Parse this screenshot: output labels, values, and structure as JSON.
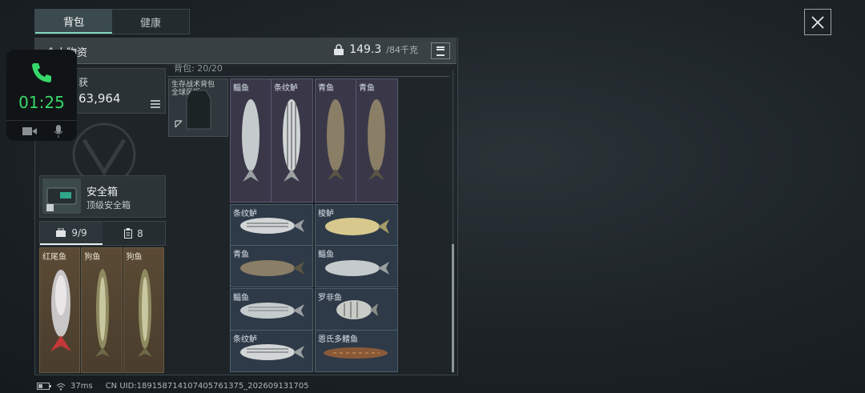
{
  "tabs": [
    {
      "label": "背包"
    },
    {
      "label": "健康"
    }
  ],
  "panel": {
    "title": "个人物资",
    "weight_value": "149.3",
    "weight_unit": "/84千克"
  },
  "value_box": {
    "label": "获",
    "value": "63,964"
  },
  "safe_box": {
    "name": "安全箱",
    "subtitle": "顶级安全箱"
  },
  "counters": [
    {
      "label": "9/9"
    },
    {
      "label": "8"
    }
  ],
  "safe_items": [
    {
      "name": "红尾鱼"
    },
    {
      "name": "狗鱼"
    },
    {
      "name": "狗鱼"
    }
  ],
  "backpack": {
    "header": "背包: 20/20",
    "bag_label": "生存战术背包 全球风版"
  },
  "fish": {
    "g1": [
      {
        "name": "鲻鱼"
      },
      {
        "name": "条纹鲈"
      }
    ],
    "g2": [
      {
        "name": "青鱼"
      },
      {
        "name": "青鱼"
      }
    ],
    "g3": [
      {
        "name": "条纹鲈"
      },
      {
        "name": "青鱼"
      }
    ],
    "g4": [
      {
        "name": "梭鲈"
      },
      {
        "name": "鲻鱼"
      }
    ],
    "g5": [
      {
        "name": "鲻鱼"
      },
      {
        "name": "条纹鲈"
      }
    ],
    "g6": [
      {
        "name": "罗非鱼"
      },
      {
        "name": "恩氏多鳍鱼"
      }
    ]
  },
  "call": {
    "timer": "01:25"
  },
  "status": {
    "ping": "37ms",
    "uid": "CN UID:18915871410740576137​5_202609131705"
  },
  "colors": {
    "accent": "#37d86a",
    "grid_blue": "#2e3a48",
    "grid_purple": "#3a3848",
    "safe_gold": "#5a4a35"
  }
}
